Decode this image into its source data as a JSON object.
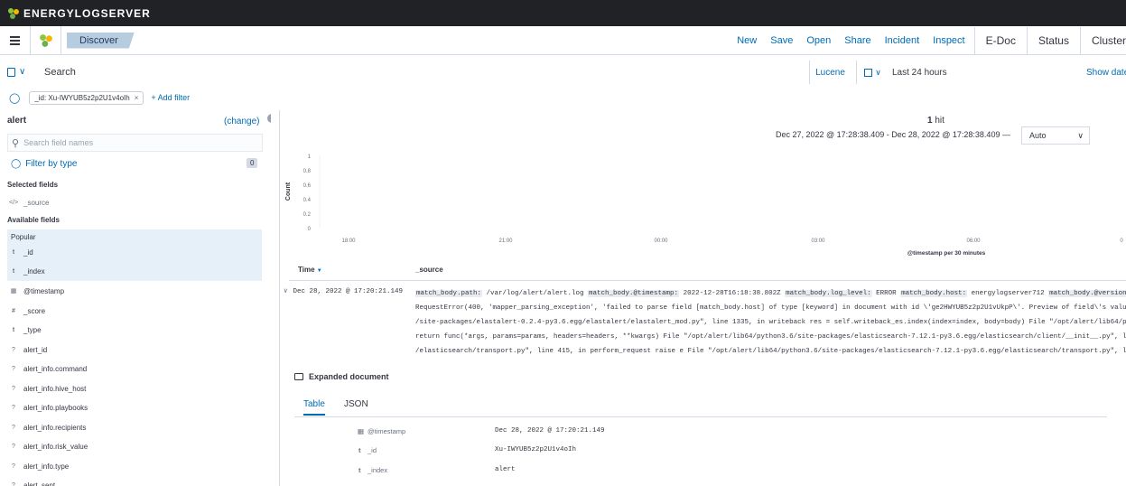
{
  "app": {
    "brand": "ENERGYLOGSERVER"
  },
  "nav": {
    "breadcrumb": "Discover",
    "links": [
      "New",
      "Save",
      "Open",
      "Share",
      "Incident",
      "Inspect"
    ],
    "items": [
      "E-Doc",
      "Status",
      "Cluster"
    ]
  },
  "query": {
    "placeholder": "Search",
    "language": "Lucene",
    "time_range": "Last 24 hours",
    "show_dates": "Show dates"
  },
  "filters": {
    "pill": "_id: Xu-IWYUB5z2p2U1v4oIh",
    "add_label": "+ Add filter"
  },
  "sidebar": {
    "index_pattern": "alert",
    "change_label": "(change)",
    "search_placeholder": "Search field names",
    "filter_by_type": "Filter by type",
    "filter_count": "0",
    "selected_label": "Selected fields",
    "selected": [
      {
        "type": "source",
        "name": "_source"
      }
    ],
    "available_label": "Available fields",
    "popular_label": "Popular",
    "popular": [
      {
        "type": "t",
        "name": "_id"
      },
      {
        "type": "t",
        "name": "_index"
      }
    ],
    "fields": [
      {
        "type": "date",
        "name": "@timestamp"
      },
      {
        "type": "num",
        "name": "_score"
      },
      {
        "type": "t",
        "name": "_type"
      },
      {
        "type": "unknown",
        "name": "alert_id"
      },
      {
        "type": "unknown",
        "name": "alert_info.command"
      },
      {
        "type": "unknown",
        "name": "alert_info.hive_host"
      },
      {
        "type": "unknown",
        "name": "alert_info.playbooks"
      },
      {
        "type": "unknown",
        "name": "alert_info.recipients"
      },
      {
        "type": "unknown",
        "name": "alert_info.risk_value"
      },
      {
        "type": "unknown",
        "name": "alert_info.type"
      },
      {
        "type": "unknown",
        "name": "alert_sent"
      }
    ]
  },
  "main": {
    "hits_count": "1",
    "hits_label": " hit",
    "range": "Dec 27, 2022 @ 17:28:38.409 - Dec 28, 2022 @ 17:28:38.409 —",
    "interval": "Auto",
    "table_headers": {
      "time": "Time",
      "source": "_source"
    },
    "row": {
      "time": "Dec 28, 2022 @ 17:20:21.149",
      "source_line1": [
        {
          "k": "match_body.path:",
          "v": " /var/log/alert/alert.log "
        },
        {
          "k": "match_body.@timestamp:",
          "v": " 2022-12-28T16:18:38.802Z "
        },
        {
          "k": "match_body.log_level:",
          "v": " ERROR "
        },
        {
          "k": "match_body.host:",
          "v": " energylogserver712 "
        },
        {
          "k": "match_body.@version",
          "v": ""
        }
      ],
      "source_line2": "RequestError(400, 'mapper_parsing_exception', 'failed to parse field [match_body.host] of type [keyword] in document with id \\'ge2HWYUB5z2p2U1vUkpP\\'. Preview of field\\'s value",
      "source_line3": "/site-packages/elastalert-0.2.4-py3.6.egg/elastalert/elastalert_mod.py\", line 1335, in writeback res = self.writeback_es.index(index=index, body=body) File \"/opt/alert/lib64/py",
      "source_line4": "return func(*args, params=params, headers=headers, **kwargs) File \"/opt/alert/lib64/python3.6/site-packages/elasticsearch-7.12.1-py3.6.egg/elasticsearch/client/__init__.py\", li",
      "source_line5": "/elasticsearch/transport.py\", line 415, in perform_request raise e File \"/opt/alert/lib64/python3.6/site-packages/elasticsearch-7.12.1-py3.6.egg/elasticsearch/transport.py\", li"
    },
    "expanded_label": "Expanded document",
    "tabs": [
      "Table",
      "JSON"
    ],
    "doc_fields": [
      {
        "type": "date",
        "name": "@timestamp",
        "value": "Dec 28, 2022 @ 17:20:21.149"
      },
      {
        "type": "t",
        "name": "_id",
        "value": "Xu-IWYUB5z2p2U1v4oIh"
      },
      {
        "type": "t",
        "name": "_index",
        "value": "alert"
      }
    ]
  },
  "chart_data": {
    "type": "bar",
    "ylabel": "Count",
    "xlabel": "@timestamp per 30 minutes",
    "y_ticks": [
      "1",
      "0.8",
      "0.6",
      "0.4",
      "0.2",
      "0"
    ],
    "x_ticks": [
      "18:00",
      "21:00",
      "00:00",
      "03:00",
      "06:00",
      "0"
    ],
    "ylim": [
      0,
      1
    ],
    "values": []
  },
  "colors": {
    "link": "#006bb4",
    "topbar": "#202225",
    "breadcrumb": "#b8cce0"
  }
}
